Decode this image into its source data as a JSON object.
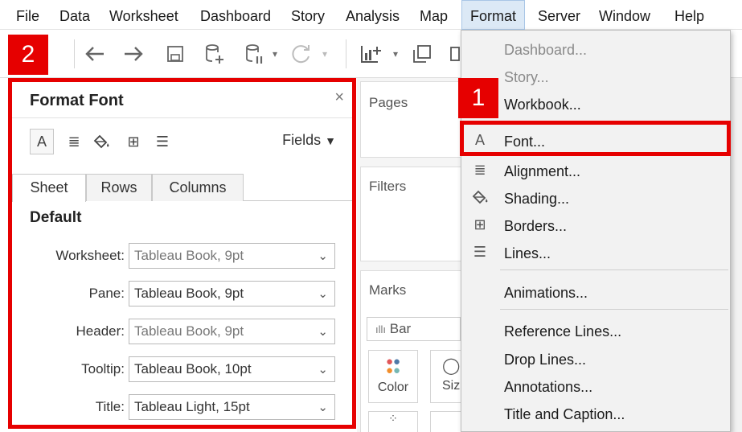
{
  "menubar": {
    "items": [
      "File",
      "Data",
      "Worksheet",
      "Dashboard",
      "Story",
      "Analysis",
      "Map",
      "Format",
      "Server",
      "Window",
      "Help"
    ]
  },
  "toolbar": {
    "icons": [
      "back-icon",
      "forward-icon",
      "save-icon",
      "new-data-source-icon",
      "pause-updates-icon",
      "refresh-icon",
      "new-worksheet-icon",
      "duplicate-icon"
    ]
  },
  "format_menu": {
    "items": [
      {
        "label": "Dashboard...",
        "disabled": true,
        "icon": ""
      },
      {
        "label": "Story...",
        "disabled": true,
        "icon": ""
      },
      {
        "label": "Workbook...",
        "disabled": false,
        "icon": ""
      },
      {
        "label": "Font...",
        "disabled": false,
        "icon": "A"
      },
      {
        "label": "Alignment...",
        "disabled": false,
        "icon": "≣"
      },
      {
        "label": "Shading...",
        "disabled": false,
        "icon": "paint-bucket-icon"
      },
      {
        "label": "Borders...",
        "disabled": false,
        "icon": "⊞"
      },
      {
        "label": "Lines...",
        "disabled": false,
        "icon": "☰"
      },
      {
        "label": "Animations...",
        "disabled": false,
        "icon": ""
      },
      {
        "label": "Reference Lines...",
        "disabled": false,
        "icon": ""
      },
      {
        "label": "Drop Lines...",
        "disabled": false,
        "icon": ""
      },
      {
        "label": "Annotations...",
        "disabled": false,
        "icon": ""
      },
      {
        "label": "Title and Caption...",
        "disabled": false,
        "icon": ""
      }
    ]
  },
  "format_pane": {
    "title": "Format Font",
    "close": "×",
    "fields_label": "Fields",
    "tabs": [
      "Sheet",
      "Rows",
      "Columns"
    ],
    "section_title": "Default",
    "rows": [
      {
        "label": "Worksheet:",
        "value": "Tableau Book, 9pt"
      },
      {
        "label": "Pane:",
        "value": "Tableau Book, 9pt"
      },
      {
        "label": "Header:",
        "value": "Tableau Book, 9pt"
      },
      {
        "label": "Tooltip:",
        "value": "Tableau Book, 10pt"
      },
      {
        "label": "Title:",
        "value": "Tableau Light, 15pt"
      }
    ]
  },
  "shelves": {
    "pages": "Pages",
    "filters": "Filters",
    "marks": "Marks",
    "mark_type": "Bar",
    "color": "Color",
    "size": "Siz"
  },
  "badges": {
    "one": "1",
    "two": "2"
  },
  "colors": {
    "highlight_red": "#e60000",
    "menu_active": "#dce9f6"
  }
}
